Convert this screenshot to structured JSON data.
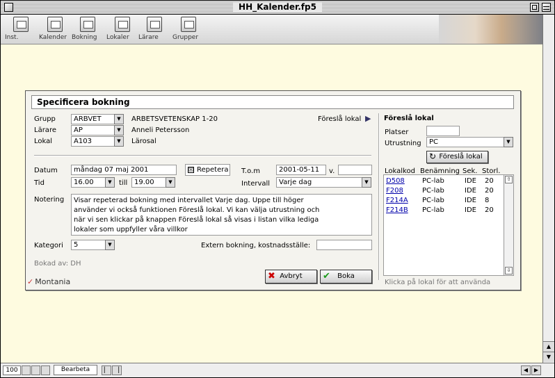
{
  "window": {
    "title": "HH_Kalender.fp5"
  },
  "toolbar": {
    "items": [
      {
        "label": "Inst.",
        "icon": "settings-icon"
      },
      {
        "label": "Kalender",
        "icon": "calendar-icon"
      },
      {
        "label": "Bokning",
        "icon": "booking-icon"
      },
      {
        "label": "Lokaler",
        "icon": "rooms-icon"
      },
      {
        "label": "Lärare",
        "icon": "teachers-icon"
      },
      {
        "label": "Grupper",
        "icon": "groups-icon"
      }
    ]
  },
  "dialog": {
    "title": "Specificera bokning",
    "grupp": {
      "label": "Grupp",
      "value": "ARBVET",
      "desc": "ARBETSVETENSKAP 1-20"
    },
    "larare": {
      "label": "Lärare",
      "value": "AP",
      "desc": "Anneli Petersson"
    },
    "lokal": {
      "label": "Lokal",
      "value": "A103",
      "desc": "Lärosal"
    },
    "suggest_link": "Föreslå lokal",
    "datum": {
      "label": "Datum",
      "value": "måndag 07 maj 2001"
    },
    "repetera": {
      "label": "Repetera",
      "checked": true,
      "mark": "☒"
    },
    "tom": {
      "label": "T.o.m",
      "value": "2001-05-11",
      "v_label": "v.",
      "v_value": ""
    },
    "tid": {
      "label": "Tid",
      "from": "16.00",
      "till_label": "till",
      "to": "19.00"
    },
    "intervall": {
      "label": "Intervall",
      "value": "Varje dag"
    },
    "notering": {
      "label": "Notering",
      "lines": [
        "Visar repeterad bokning med intervallet Varje dag. Uppe till höger",
        "använder vi också funktionen Föreslå lokal. Vi kan välja utrustning och",
        "när vi sen klickar på knappen Föreslå lokal så visas i listan vilka lediga",
        "lokaler som uppfyller våra villkor"
      ]
    },
    "kategori": {
      "label": "Kategori",
      "value": "5"
    },
    "extern": {
      "label": "Extern bokning, kostnadsställe:",
      "value": ""
    },
    "bokad_av": "Bokad av: DH",
    "buttons": {
      "cancel": "Avbryt",
      "book": "Boka"
    },
    "logo": "Montania"
  },
  "suggest": {
    "heading": "Föreslå lokal",
    "platser": {
      "label": "Platser",
      "value": ""
    },
    "utrustning": {
      "label": "Utrustning",
      "value": "PC"
    },
    "button": "Föreslå lokal",
    "columns": [
      "Lokalkod",
      "Benämning",
      "Sek.",
      "Storl."
    ],
    "rows": [
      [
        "D508",
        "PC-lab",
        "IDE",
        "20"
      ],
      [
        "F208",
        "PC-lab",
        "IDE",
        "20"
      ],
      [
        "F214A",
        "PC-lab",
        "IDE",
        "8"
      ],
      [
        "F214B",
        "PC-lab",
        "IDE",
        "20"
      ]
    ],
    "hint": "Klicka på lokal för att använda"
  },
  "statusbar": {
    "zoom": "100",
    "mode": "Bearbeta"
  }
}
